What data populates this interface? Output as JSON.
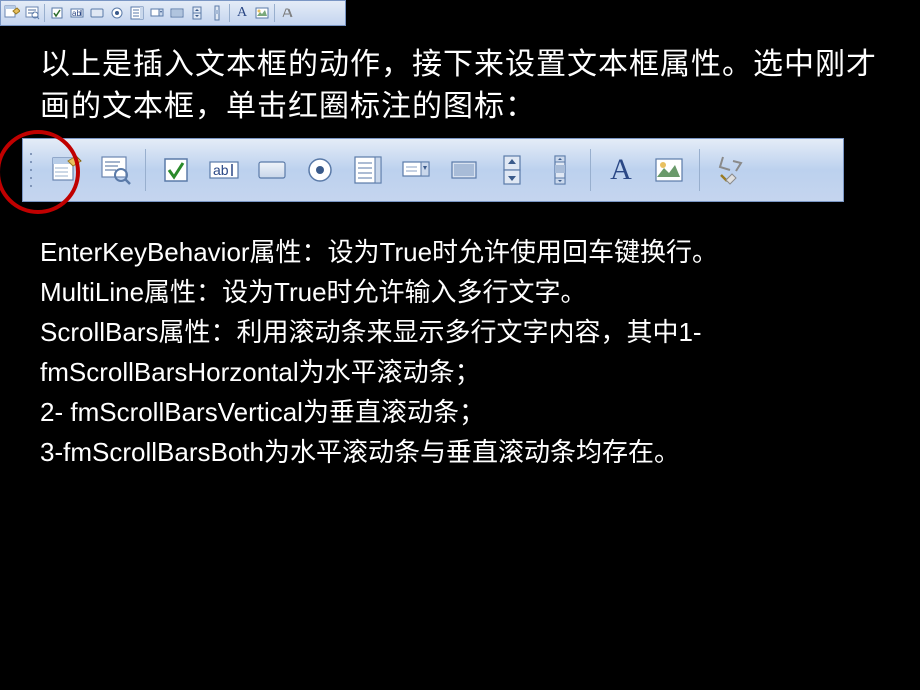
{
  "toolbar_small": {
    "icons": [
      "properties-icon",
      "view-code-icon",
      "sep",
      "checkbox-icon",
      "textbox-icon",
      "command-button-icon",
      "option-button-icon",
      "listbox-icon",
      "combobox-icon",
      "toggle-icon",
      "spin-button-icon",
      "scrollbar-icon",
      "sep",
      "label-a-icon",
      "image-icon",
      "sep",
      "more-controls-icon"
    ]
  },
  "para1": "以上是插入文本框的动作，接下来设置文本框属性。选中刚才画的文本框，单击红圈标注的图标：",
  "toolbar_big": {
    "icons": [
      "properties-icon",
      "view-code-icon",
      "sep",
      "checkbox-icon",
      "textbox-icon",
      "command-button-icon",
      "option-button-icon",
      "listbox-icon",
      "combobox-icon",
      "toggle-icon",
      "spin-button-icon",
      "scrollbar-icon",
      "sep",
      "label-a-icon",
      "image-icon",
      "sep",
      "more-controls-icon"
    ]
  },
  "para2_lines": {
    "l1": "EnterKeyBehavior属性：设为True时允许使用回车键换行。",
    "l2": "MultiLine属性：设为True时允许输入多行文字。",
    "l3": "ScrollBars属性：利用滚动条来显示多行文字内容，其中1-fmScrollBarsHorzontal为水平滚动条；",
    "l4": "2- fmScrollBarsVertical为垂直滚动条；",
    "l5": "3-fmScrollBarsBoth为水平滚动条与垂直滚动条均存在。"
  }
}
